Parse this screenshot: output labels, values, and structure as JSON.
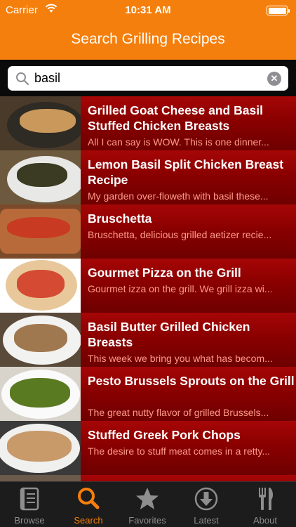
{
  "status_bar": {
    "carrier": "Carrier",
    "time": "10:31 AM"
  },
  "nav": {
    "title": "Search Grilling Recipes"
  },
  "search": {
    "value": "basil"
  },
  "results": [
    {
      "title": "Grilled Goat Cheese and Basil Stuffed Chicken Breasts",
      "description": "All I can say is WOW.  This is one dinner..."
    },
    {
      "title": "Lemon Basil Split Chicken Breast Recipe",
      "description": "My garden over-floweth with basil these..."
    },
    {
      "title": "Bruschetta",
      "description": "Bruschetta, delicious grilled aetizer recie..."
    },
    {
      "title": "Gourmet Pizza on the Grill",
      "description": "Gourmet izza on the grill.  We grill izza wi..."
    },
    {
      "title": "Basil Butter Grilled Chicken Breasts",
      "description": "This week we bring you what has becom..."
    },
    {
      "title": "Pesto Brussels Sprouts on the Grill",
      "description": "The great nutty flavor of grilled Brussels..."
    },
    {
      "title": "Stuffed Greek Pork Chops",
      "description": "The desire to stuff meat comes in a retty..."
    },
    {
      "title": "",
      "description": ""
    }
  ],
  "tabs": [
    {
      "label": "Browse",
      "icon": "browse-icon"
    },
    {
      "label": "Search",
      "icon": "search-icon"
    },
    {
      "label": "Favorites",
      "icon": "star-icon"
    },
    {
      "label": "Latest",
      "icon": "download-icon"
    },
    {
      "label": "About",
      "icon": "utensils-icon"
    }
  ],
  "colors": {
    "accent": "#f47f0c",
    "row": "#8a0000",
    "description": "#ff9a8a"
  }
}
